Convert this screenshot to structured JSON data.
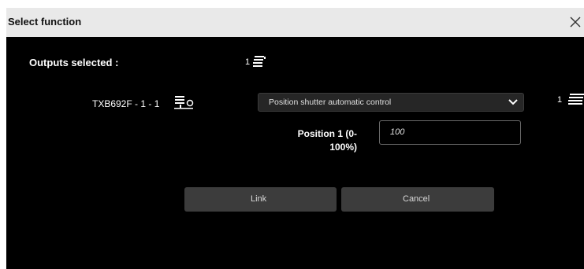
{
  "dialog": {
    "title": "Select function"
  },
  "outputs": {
    "label": "Outputs selected :",
    "count": "1"
  },
  "device": {
    "name": "TXB692F - 1 - 1",
    "select_value": "Position shutter automatic control",
    "right_count": "1"
  },
  "position_field": {
    "label_line1": "Position 1 (0-",
    "label_line2": "100%)",
    "value": "100"
  },
  "buttons": {
    "link": "Link",
    "cancel": "Cancel"
  },
  "colors": {
    "titlebar": "#e9e9e9",
    "dialog_bg": "#000000",
    "button_bg": "#3c3c3c",
    "select_bg": "#262626"
  }
}
